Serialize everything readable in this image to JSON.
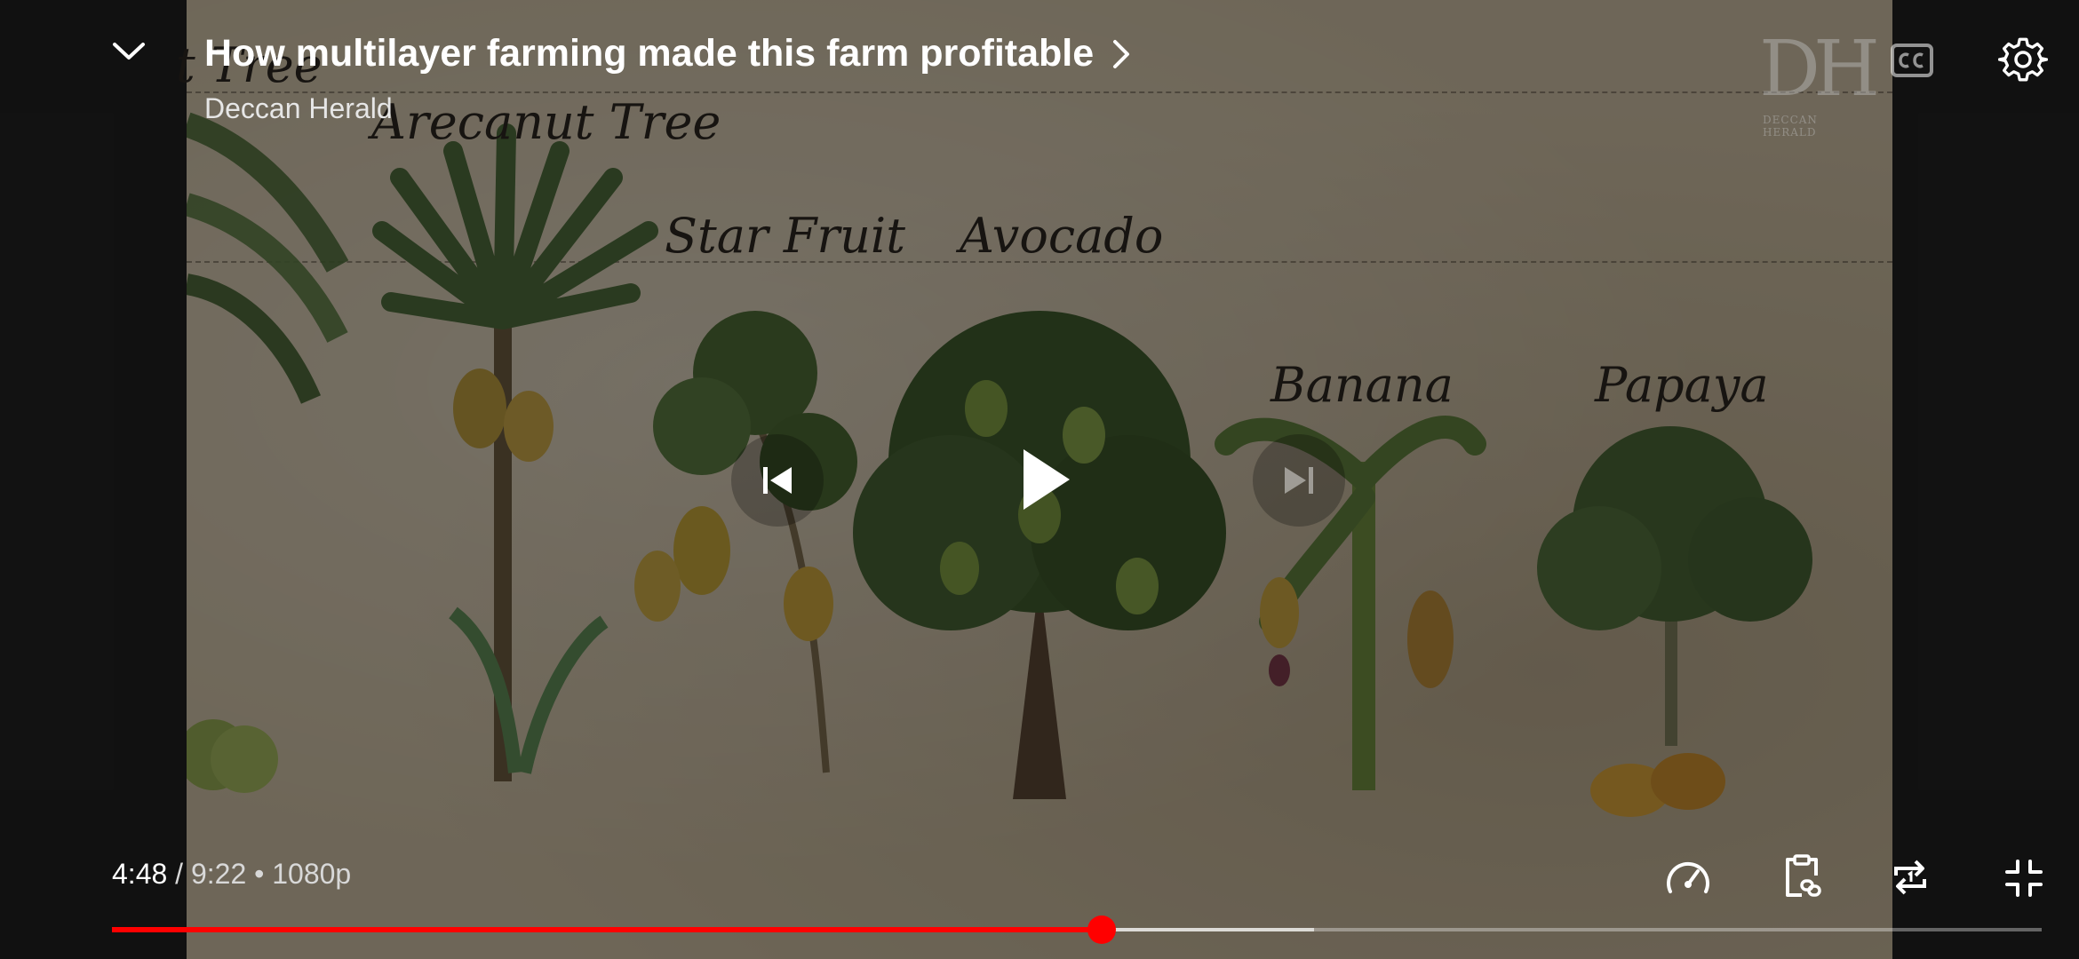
{
  "video": {
    "title": "How multilayer farming made this farm profitable",
    "channel": "Deccan Herald",
    "watermark_letters": "DH",
    "watermark_text": "DECCAN HERALD",
    "current_time": "4:48",
    "duration": "9:22",
    "quality": "1080p",
    "played_fraction": 0.513,
    "buffered_fraction": 0.623,
    "labels": {
      "tree_partial": "t Tree",
      "arecanut": "Arecanut Tree",
      "starfruit": "Star Fruit",
      "avocado": "Avocado",
      "banana": "Banana",
      "papaya": "Papaya"
    }
  },
  "controls": {
    "minimize_icon": "chevron-down-icon",
    "title_chevron_icon": "chevron-right-icon",
    "captions_icon": "cc-icon",
    "settings_icon": "gear-icon",
    "previous_icon": "skip-previous-icon",
    "play_icon": "play-icon",
    "next_icon": "skip-next-icon",
    "speed_icon": "speedometer-icon",
    "clip_icon": "clipboard-link-icon",
    "loop_icon": "repeat-one-icon",
    "exit_fullscreen_icon": "exit-fullscreen-icon"
  },
  "colors": {
    "progress_played": "#ff0000",
    "overlay": "rgba(0,0,0,0.45)"
  }
}
